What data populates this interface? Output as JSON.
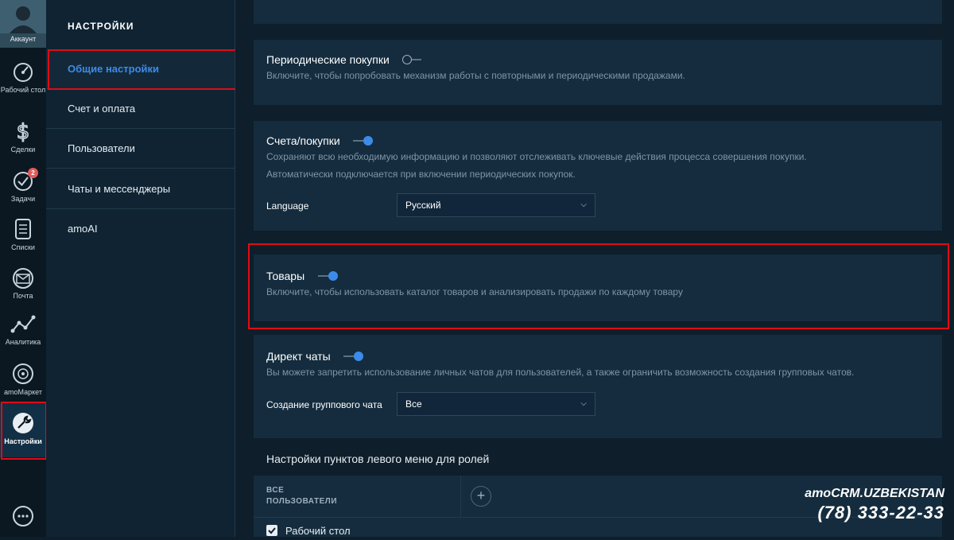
{
  "rail": {
    "account": "Аккаунт",
    "items": [
      {
        "label": "Рабочий стол",
        "icon": "dashboard-icon"
      },
      {
        "label": "Сделки",
        "icon": "dollar-icon"
      },
      {
        "label": "Задачи",
        "icon": "checkmark-icon",
        "badge": "2"
      },
      {
        "label": "Списки",
        "icon": "list-icon"
      },
      {
        "label": "Почта",
        "icon": "mail-icon"
      },
      {
        "label": "Аналитика",
        "icon": "analytics-icon"
      },
      {
        "label": "amoМаркет",
        "icon": "market-icon"
      },
      {
        "label": "Настройки",
        "icon": "wrench-icon"
      }
    ]
  },
  "settings_nav": {
    "title": "НАСТРОЙКИ",
    "items": [
      {
        "label": "Общие настройки"
      },
      {
        "label": "Счет и оплата"
      },
      {
        "label": "Пользователи"
      },
      {
        "label": "Чаты и мессенджеры"
      },
      {
        "label": "amoAI"
      }
    ]
  },
  "panels": {
    "periodic": {
      "title": "Периодические покупки",
      "enabled": false,
      "desc": "Включите, чтобы попробовать механизм работы с повторными и периодическими продажами."
    },
    "invoices": {
      "title": "Счета/покупки",
      "enabled": true,
      "desc1": "Сохраняют всю необходимую информацию и позволяют отслеживать ключевые действия процесса совершения покупки.",
      "desc2": "Автоматически подключается при включении периодических покупок.",
      "language_label": "Language",
      "language_value": "Русский"
    },
    "goods": {
      "title": "Товары",
      "enabled": true,
      "desc": "Включите, чтобы использовать каталог товаров и анализировать продажи по каждому товару"
    },
    "direct_chats": {
      "title": "Директ чаты",
      "enabled": true,
      "desc": "Вы можете запретить использование личных чатов для пользователей, а также ограничить возможность создания групповых чатов.",
      "group_label": "Создание группового чата",
      "group_value": "Все"
    }
  },
  "roles": {
    "section_title": "Настройки пунктов левого меню для ролей",
    "all_users_line1": "ВСЕ",
    "all_users_line2": "ПОЛЬЗОВАТЕЛИ",
    "add": "+",
    "row_label": "Рабочий стол"
  },
  "brand": {
    "name": "amoCRM.UZBEKISTAN",
    "phone": "(78) 333-22-33"
  },
  "colors": {
    "accent": "#3d8be8",
    "highlight": "#e00b14",
    "badge": "#e45b5b"
  }
}
